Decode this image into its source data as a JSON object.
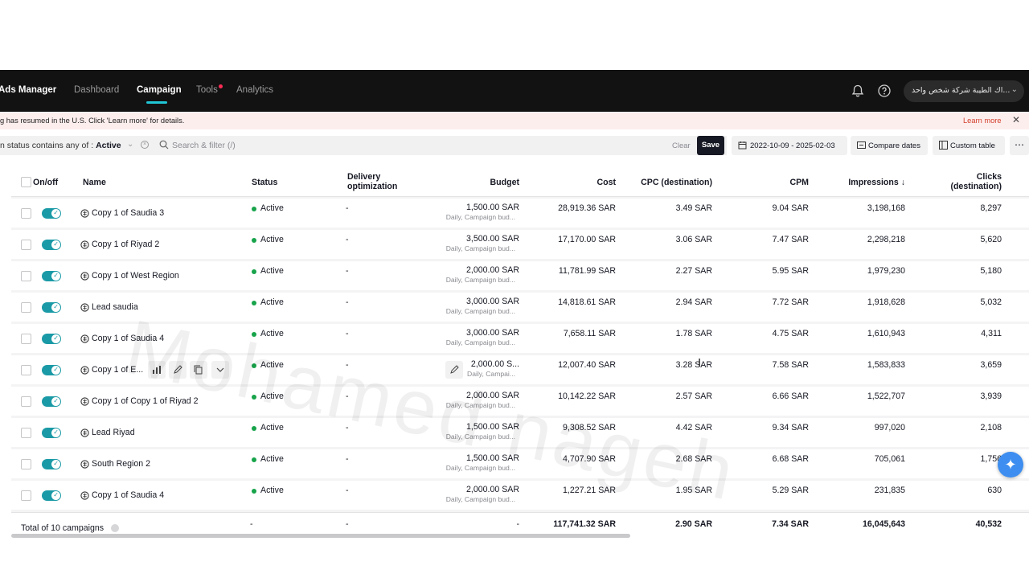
{
  "nav": {
    "brand": "Ads Manager",
    "tabs": [
      {
        "label": "Dashboard"
      },
      {
        "label": "Campaign"
      },
      {
        "label": "Tools"
      },
      {
        "label": "Analytics"
      }
    ],
    "account_name": "اك الطيبة شركة شخص واحد..."
  },
  "banner": {
    "text": "g has resumed in the U.S. Click 'Learn more' for details.",
    "learn_more": "Learn more"
  },
  "filter": {
    "label": "n status contains any of :",
    "value": "Active",
    "search_placeholder": "Search & filter (/)",
    "clear": "Clear",
    "save": "Save",
    "date_range": "2022-10-09 - 2025-02-03",
    "compare": "Compare dates",
    "custom_table": "Custom table",
    "more": "⋯"
  },
  "table": {
    "headers": {
      "onoff": "On/off",
      "name": "Name",
      "status": "Status",
      "delivery_1": "Delivery",
      "delivery_2": "optimization",
      "budget": "Budget",
      "cost": "Cost",
      "cpc": "CPC (destination)",
      "cpm": "CPM",
      "impressions": "Impressions ↓",
      "clicks_1": "Clicks",
      "clicks_2": "(destination)"
    },
    "rows": [
      {
        "name": "Copy 1 of Saudia 3",
        "status": "Active",
        "delivery": "-",
        "budget": "1,500.00 SAR",
        "budget_sub": "Daily, Campaign bud...",
        "cost": "28,919.36 SAR",
        "cpc": "3.49 SAR",
        "cpm": "9.04 SAR",
        "impressions": "3,198,168",
        "clicks": "8,297"
      },
      {
        "name": "Copy 1 of Riyad 2",
        "status": "Active",
        "delivery": "-",
        "budget": "3,500.00 SAR",
        "budget_sub": "Daily, Campaign bud...",
        "cost": "17,170.00 SAR",
        "cpc": "3.06 SAR",
        "cpm": "7.47 SAR",
        "impressions": "2,298,218",
        "clicks": "5,620"
      },
      {
        "name": "Copy 1 of West Region",
        "status": "Active",
        "delivery": "-",
        "budget": "2,000.00 SAR",
        "budget_sub": "Daily, Campaign bud...",
        "cost": "11,781.99 SAR",
        "cpc": "2.27 SAR",
        "cpm": "5.95 SAR",
        "impressions": "1,979,230",
        "clicks": "5,180"
      },
      {
        "name": "Lead saudia",
        "status": "Active",
        "delivery": "-",
        "budget": "3,000.00 SAR",
        "budget_sub": "Daily, Campaign bud...",
        "cost": "14,818.61 SAR",
        "cpc": "2.94 SAR",
        "cpm": "7.72 SAR",
        "impressions": "1,918,628",
        "clicks": "5,032"
      },
      {
        "name": "Copy 1 of Saudia 4",
        "status": "Active",
        "delivery": "-",
        "budget": "3,000.00 SAR",
        "budget_sub": "Daily, Campaign bud...",
        "cost": "7,658.11 SAR",
        "cpc": "1.78 SAR",
        "cpm": "4.75 SAR",
        "impressions": "1,610,943",
        "clicks": "4,311"
      },
      {
        "name": "Copy 1 of E...",
        "status": "Active",
        "delivery": "-",
        "budget": "2,000.00 S...",
        "budget_sub": "Daily, Campai...",
        "cost": "12,007.40 SAR",
        "cpc": "3.28 SAR",
        "cpm": "7.58 SAR",
        "impressions": "1,583,833",
        "clicks": "3,659"
      },
      {
        "name": "Copy 1 of Copy 1 of Riyad 2",
        "status": "Active",
        "delivery": "-",
        "budget": "2,000.00 SAR",
        "budget_sub": "Daily, Campaign bud...",
        "cost": "10,142.22 SAR",
        "cpc": "2.57 SAR",
        "cpm": "6.66 SAR",
        "impressions": "1,522,707",
        "clicks": "3,939"
      },
      {
        "name": "Lead Riyad",
        "status": "Active",
        "delivery": "-",
        "budget": "1,500.00 SAR",
        "budget_sub": "Daily, Campaign bud...",
        "cost": "9,308.52 SAR",
        "cpc": "4.42 SAR",
        "cpm": "9.34 SAR",
        "impressions": "997,020",
        "clicks": "2,108"
      },
      {
        "name": "South Region 2",
        "status": "Active",
        "delivery": "-",
        "budget": "1,500.00 SAR",
        "budget_sub": "Daily, Campaign bud...",
        "cost": "4,707.90 SAR",
        "cpc": "2.68 SAR",
        "cpm": "6.68 SAR",
        "impressions": "705,061",
        "clicks": "1,756"
      },
      {
        "name": "Copy 1 of Saudia 4",
        "status": "Active",
        "delivery": "-",
        "budget": "2,000.00 SAR",
        "budget_sub": "Daily, Campaign bud...",
        "cost": "1,227.21 SAR",
        "cpc": "1.95 SAR",
        "cpm": "5.29 SAR",
        "impressions": "231,835",
        "clicks": "630"
      }
    ],
    "total": {
      "label": "Total of 10 campaigns",
      "status": "-",
      "delivery": "-",
      "budget": "-",
      "cost": "117,741.32 SAR",
      "cpc": "2.90 SAR",
      "cpm": "7.34 SAR",
      "impressions": "16,045,643",
      "clicks": "40,532"
    }
  },
  "watermark": "Mohamed nageh",
  "colors": {
    "accent": "#1a9aa6",
    "active_dot": "#17a34a",
    "nav_bg": "#121212",
    "banner_bg": "#fdeeee",
    "learn_more": "#d2402d"
  }
}
